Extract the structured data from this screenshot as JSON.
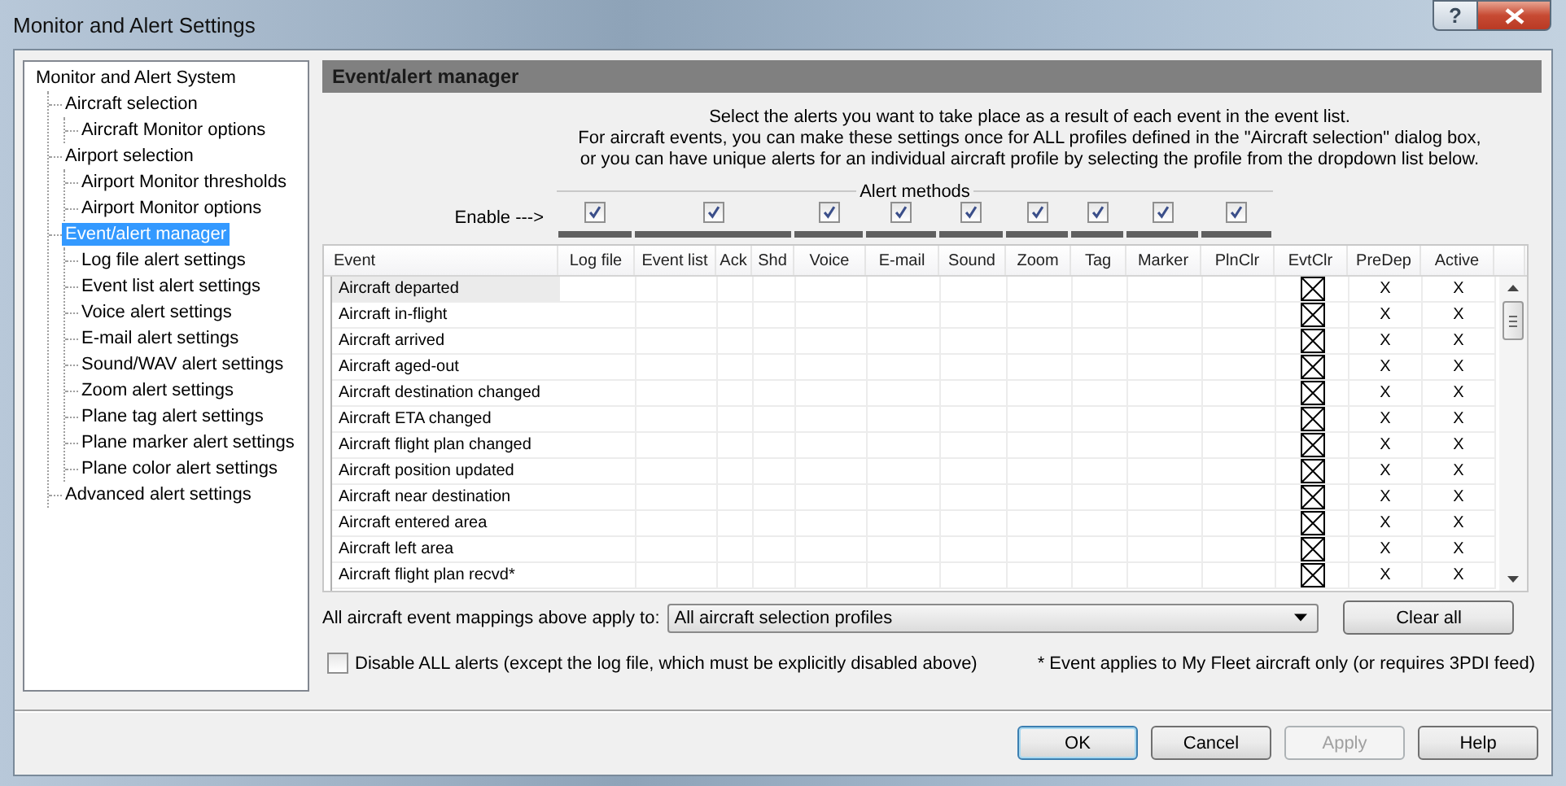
{
  "window": {
    "title": "Monitor and Alert Settings",
    "help_glyph": "?"
  },
  "tree": [
    {
      "label": "Monitor and Alert System",
      "selected": false,
      "children": [
        {
          "label": "Aircraft selection",
          "selected": false,
          "children": [
            {
              "label": "Aircraft Monitor options",
              "selected": false
            }
          ]
        },
        {
          "label": "Airport selection",
          "selected": false,
          "children": [
            {
              "label": "Airport Monitor thresholds",
              "selected": false
            },
            {
              "label": "Airport Monitor options",
              "selected": false
            }
          ]
        },
        {
          "label": "Event/alert manager",
          "selected": true,
          "children": [
            {
              "label": "Log file alert settings",
              "selected": false
            },
            {
              "label": "Event list alert settings",
              "selected": false
            },
            {
              "label": "Voice alert settings",
              "selected": false
            },
            {
              "label": "E-mail alert settings",
              "selected": false
            },
            {
              "label": "Sound/WAV alert settings",
              "selected": false
            },
            {
              "label": "Zoom alert settings",
              "selected": false
            },
            {
              "label": "Plane tag alert settings",
              "selected": false
            },
            {
              "label": "Plane marker alert settings",
              "selected": false
            },
            {
              "label": "Plane color alert settings",
              "selected": false
            }
          ]
        },
        {
          "label": "Advanced alert settings",
          "selected": false
        }
      ]
    }
  ],
  "panel": {
    "heading": "Event/alert manager",
    "intro": [
      "Select the alerts you want to take place as a result of each event in the event list.",
      "For aircraft events, you can make these settings once for ALL profiles defined in the \"Aircraft selection\" dialog box,",
      "or you can have unique alerts for an individual aircraft profile by selecting the profile from the dropdown list below."
    ],
    "alert_methods_label": "Alert methods",
    "enable_label": "Enable --->",
    "enable_checkboxes": [
      {
        "checked": true
      },
      {
        "checked": true
      },
      {
        "checked": true
      },
      {
        "checked": true
      },
      {
        "checked": true
      },
      {
        "checked": true
      },
      {
        "checked": true
      },
      {
        "checked": true
      },
      {
        "checked": true
      }
    ]
  },
  "table": {
    "columns": [
      "Event",
      "Log file",
      "Event list",
      "Ack",
      "Shd",
      "Voice",
      "E-mail",
      "Sound",
      "Zoom",
      "Tag",
      "Marker",
      "PlnClr",
      "EvtClr",
      "PreDep",
      "Active"
    ],
    "rows": [
      {
        "event": "Aircraft departed",
        "selected": true,
        "evtclr_marked": true,
        "predep": "X",
        "active": "X"
      },
      {
        "event": "Aircraft in-flight",
        "selected": false,
        "evtclr_marked": true,
        "predep": "X",
        "active": "X"
      },
      {
        "event": "Aircraft arrived",
        "selected": false,
        "evtclr_marked": true,
        "predep": "X",
        "active": "X"
      },
      {
        "event": "Aircraft aged-out",
        "selected": false,
        "evtclr_marked": true,
        "predep": "X",
        "active": "X"
      },
      {
        "event": "Aircraft destination changed",
        "selected": false,
        "evtclr_marked": true,
        "predep": "X",
        "active": "X"
      },
      {
        "event": "Aircraft ETA changed",
        "selected": false,
        "evtclr_marked": true,
        "predep": "X",
        "active": "X"
      },
      {
        "event": "Aircraft flight plan changed",
        "selected": false,
        "evtclr_marked": true,
        "predep": "X",
        "active": "X"
      },
      {
        "event": "Aircraft position updated",
        "selected": false,
        "evtclr_marked": true,
        "predep": "X",
        "active": "X"
      },
      {
        "event": "Aircraft near destination",
        "selected": false,
        "evtclr_marked": true,
        "predep": "X",
        "active": "X"
      },
      {
        "event": "Aircraft entered area",
        "selected": false,
        "evtclr_marked": true,
        "predep": "X",
        "active": "X"
      },
      {
        "event": "Aircraft left area",
        "selected": false,
        "evtclr_marked": true,
        "predep": "X",
        "active": "X"
      },
      {
        "event": "Aircraft flight plan recvd*",
        "selected": false,
        "evtclr_marked": true,
        "predep": "X",
        "active": "X"
      }
    ]
  },
  "mapping": {
    "label": "All aircraft event mappings above apply to:",
    "value": "All aircraft selection profiles",
    "clear_button": "Clear all"
  },
  "disable_all": {
    "label": "Disable ALL alerts (except the log file, which must be explicitly disabled above)",
    "checked": false
  },
  "footnote": "* Event applies to My Fleet aircraft only (or requires 3PDI feed)",
  "buttons": [
    {
      "label": "OK",
      "default": true,
      "disabled": false
    },
    {
      "label": "Cancel",
      "default": false,
      "disabled": false
    },
    {
      "label": "Apply",
      "default": false,
      "disabled": true
    },
    {
      "label": "Help",
      "default": false,
      "disabled": false
    }
  ]
}
